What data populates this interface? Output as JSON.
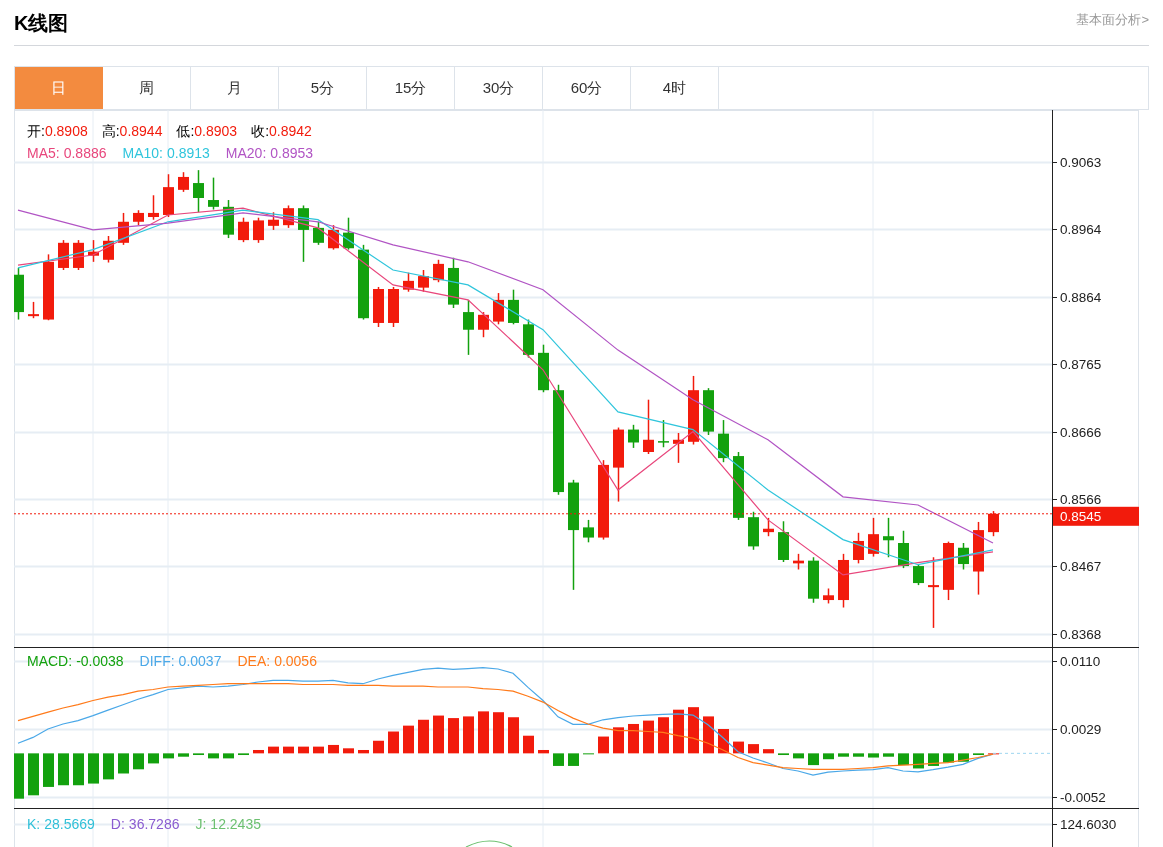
{
  "header": {
    "title": "K线图",
    "link": "基本面分析>"
  },
  "tabs": [
    {
      "label": "日",
      "selected": true
    },
    {
      "label": "周",
      "selected": false
    },
    {
      "label": "月",
      "selected": false
    },
    {
      "label": "5分",
      "selected": false
    },
    {
      "label": "15分",
      "selected": false
    },
    {
      "label": "30分",
      "selected": false
    },
    {
      "label": "60分",
      "selected": false
    },
    {
      "label": "4时",
      "selected": false
    }
  ],
  "main_chart": {
    "ohlc_legend": [
      {
        "label": "开:",
        "value": "0.8908"
      },
      {
        "label": "高:",
        "value": "0.8944"
      },
      {
        "label": "低:",
        "value": "0.8903"
      },
      {
        "label": "收:",
        "value": "0.8942"
      }
    ],
    "ma_legend": [
      {
        "name": "MA5:",
        "value": "0.8886",
        "color": "#e8467c"
      },
      {
        "name": "MA10:",
        "value": "0.8913",
        "color": "#2fc5dc"
      },
      {
        "name": "MA20:",
        "value": "0.8953",
        "color": "#b154c4"
      }
    ],
    "axis_labels": [
      "0.9063",
      "0.8964",
      "0.8864",
      "0.8765",
      "0.8666",
      "0.8566",
      "0.8467",
      "0.8368"
    ],
    "current_price": "0.8545"
  },
  "macd_chart": {
    "legend": [
      {
        "name": "MACD:",
        "value": "-0.0038",
        "color": "#13a10e"
      },
      {
        "name": "DIFF:",
        "value": "0.0037",
        "color": "#4aa8e8"
      },
      {
        "name": "DEA:",
        "value": "0.0056",
        "color": "#ff7a1a"
      }
    ],
    "axis_labels": [
      "0.0110",
      "0.0029",
      "-0.0052"
    ]
  },
  "kdj_chart": {
    "legend": [
      {
        "name": "K:",
        "value": "28.5669",
        "color": "#30c0d8"
      },
      {
        "name": "D:",
        "value": "36.7286",
        "color": "#8a5cd0"
      },
      {
        "name": "J:",
        "value": "12.2435",
        "color": "#6cc070"
      }
    ],
    "axis_label": "124.6030"
  }
}
